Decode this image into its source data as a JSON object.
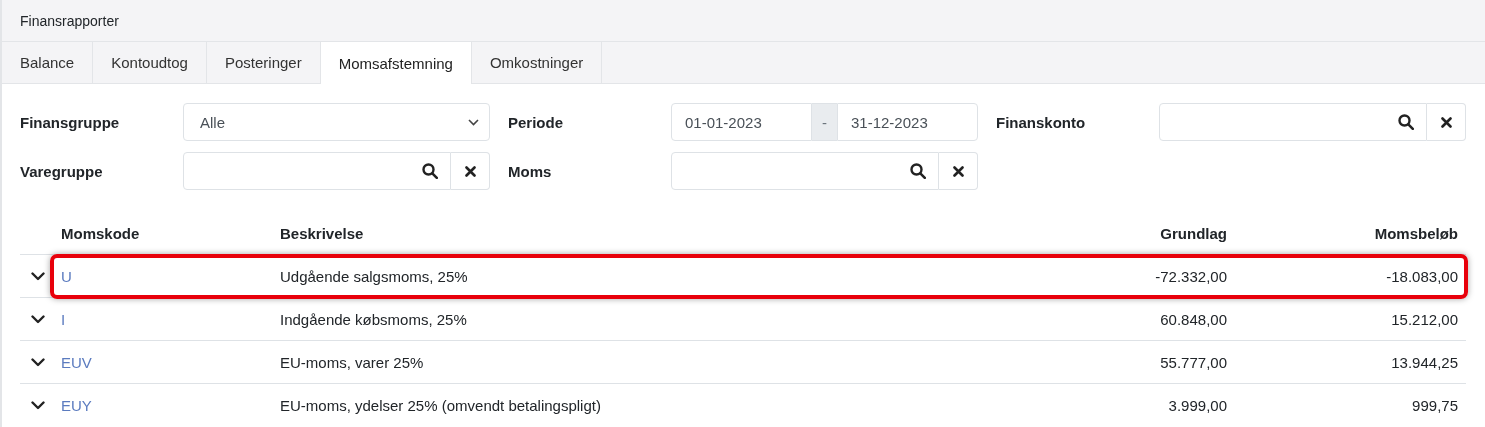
{
  "header": {
    "title": "Finansrapporter"
  },
  "tabs": [
    {
      "label": "Balance",
      "selected": false
    },
    {
      "label": "Kontoudtog",
      "selected": false
    },
    {
      "label": "Posteringer",
      "selected": false
    },
    {
      "label": "Momsafstemning",
      "selected": true
    },
    {
      "label": "Omkostninger",
      "selected": false
    }
  ],
  "filters": [
    {
      "label": "Finansgruppe",
      "kind": "select",
      "value": "Alle"
    },
    {
      "label": "Periode",
      "kind": "daterange",
      "from": "01-01-2023",
      "separator": "-",
      "to": "31-12-2023"
    },
    {
      "label": "Finanskonto",
      "kind": "lookup"
    },
    {
      "label": "Varegruppe",
      "kind": "lookup"
    },
    {
      "label": "Moms",
      "kind": "lookup"
    }
  ],
  "table": {
    "columns": [
      "Momskode",
      "Beskrivelse",
      "Grundlag",
      "Momsbeløb"
    ],
    "rows": [
      {
        "code": "U",
        "description": "Udgående salgsmoms, 25%",
        "base": "-72.332,00",
        "vat": "-18.083,00",
        "highlighted": true
      },
      {
        "code": "I",
        "description": "Indgående købsmoms, 25%",
        "base": "60.848,00",
        "vat": "15.212,00",
        "highlighted": false
      },
      {
        "code": "EUV",
        "description": "EU-moms, varer 25%",
        "base": "55.777,00",
        "vat": "13.944,25",
        "highlighted": false
      },
      {
        "code": "EUY",
        "description": "EU-moms, ydelser 25% (omvendt betalingspligt)",
        "base": "3.999,00",
        "vat": "999,75",
        "highlighted": false
      }
    ]
  }
}
